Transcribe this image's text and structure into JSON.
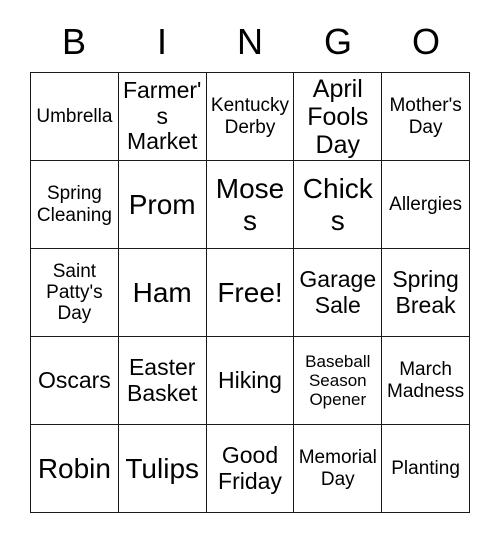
{
  "header": {
    "letters": [
      "B",
      "I",
      "N",
      "G",
      "O"
    ]
  },
  "grid": {
    "rows": [
      [
        {
          "label": "Umbrella",
          "size": "sm"
        },
        {
          "label": "Farmer's Market",
          "size": "md"
        },
        {
          "label": "Kentucky Derby",
          "size": "sm"
        },
        {
          "label": "April Fools Day",
          "size": "lg"
        },
        {
          "label": "Mother's Day",
          "size": "sm"
        }
      ],
      [
        {
          "label": "Spring Cleaning",
          "size": "sm"
        },
        {
          "label": "Prom",
          "size": "xl"
        },
        {
          "label": "Moses",
          "size": "xl"
        },
        {
          "label": "Chicks",
          "size": "xl"
        },
        {
          "label": "Allergies",
          "size": "sm"
        }
      ],
      [
        {
          "label": "Saint Patty's Day",
          "size": "sm"
        },
        {
          "label": "Ham",
          "size": "xl"
        },
        {
          "label": "Free!",
          "size": "xl"
        },
        {
          "label": "Garage Sale",
          "size": "md"
        },
        {
          "label": "Spring Break",
          "size": "md"
        }
      ],
      [
        {
          "label": "Oscars",
          "size": "md"
        },
        {
          "label": "Easter Basket",
          "size": "md"
        },
        {
          "label": "Hiking",
          "size": "md"
        },
        {
          "label": "Baseball Season Opener",
          "size": "xs"
        },
        {
          "label": "March Madness",
          "size": "sm"
        }
      ],
      [
        {
          "label": "Robin",
          "size": "xl"
        },
        {
          "label": "Tulips",
          "size": "xl"
        },
        {
          "label": "Good Friday",
          "size": "md"
        },
        {
          "label": "Memorial Day",
          "size": "sm"
        },
        {
          "label": "Planting",
          "size": "sm"
        }
      ]
    ]
  },
  "colors": {
    "background": "#ffffff",
    "border": "#1a1a1a",
    "text": "#000000"
  }
}
